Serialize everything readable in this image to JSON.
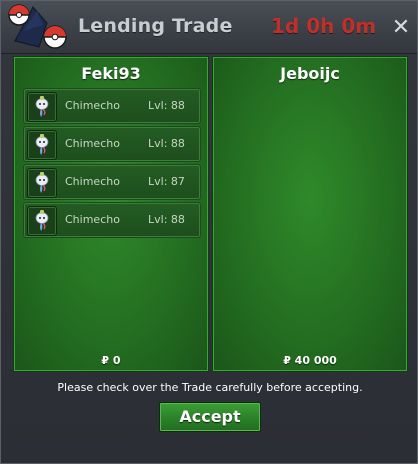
{
  "window": {
    "title": "Lending Trade",
    "timer": "1d 0h 0m",
    "close_icon": "close-x-icon"
  },
  "left_panel": {
    "player": "Feki93",
    "pokemon": [
      {
        "name": "Chimecho",
        "level": "Lvl: 88",
        "icon": "chimecho-sprite-icon"
      },
      {
        "name": "Chimecho",
        "level": "Lvl: 88",
        "icon": "chimecho-sprite-icon"
      },
      {
        "name": "Chimecho",
        "level": "Lvl: 87",
        "icon": "chimecho-sprite-icon"
      },
      {
        "name": "Chimecho",
        "level": "Lvl: 88",
        "icon": "chimecho-sprite-icon"
      }
    ],
    "money": "₽ 0"
  },
  "right_panel": {
    "player": "Jeboijc",
    "money": "₽ 40 000"
  },
  "footer": {
    "notice": "Please check over the Trade carefully before accepting.",
    "accept_label": "Accept"
  },
  "colors": {
    "panel_green": "#246f21",
    "timer_red": "#c0302a",
    "button_green": "#2c842a"
  }
}
